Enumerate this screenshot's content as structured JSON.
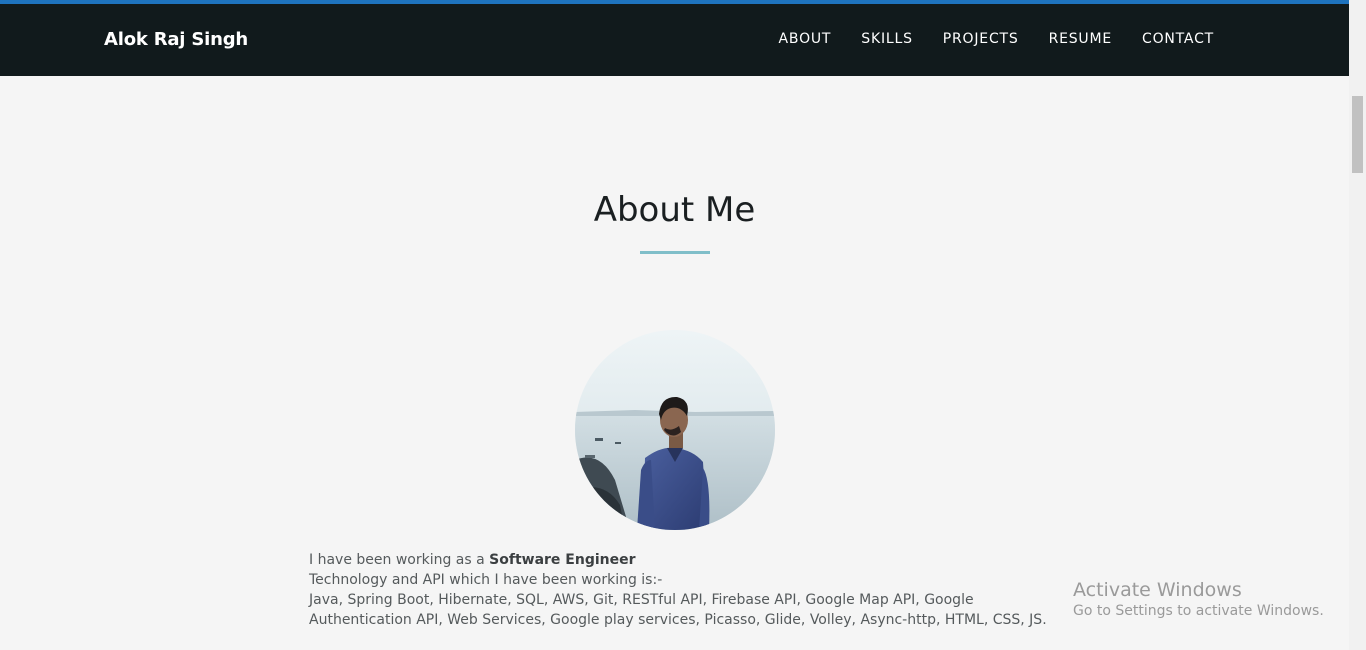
{
  "nav": {
    "brand": "Alok Raj Singh",
    "links": [
      "ABOUT",
      "SKILLS",
      "PROJECTS",
      "RESUME",
      "CONTACT"
    ]
  },
  "about": {
    "title": "About Me",
    "intro_prefix": "I have been working as a ",
    "intro_role": "Software Engineer",
    "tech_label": "Technology and API which I have been working is:-",
    "tech_list": "Java, Spring Boot, Hibernate, SQL, AWS, Git, RESTful API, Firebase API, Google Map API, Google Authentication API, Web Services, Google play services, Picasso, Glide, Volley, Async-http, HTML, CSS, JS."
  },
  "watermark": {
    "title": "Activate Windows",
    "subtitle": "Go to Settings to activate Windows."
  },
  "colors": {
    "nav_bg": "#111a1c",
    "accent_top": "#1e73be",
    "title_underline": "#80bec9",
    "page_bg": "#f5f5f5"
  }
}
